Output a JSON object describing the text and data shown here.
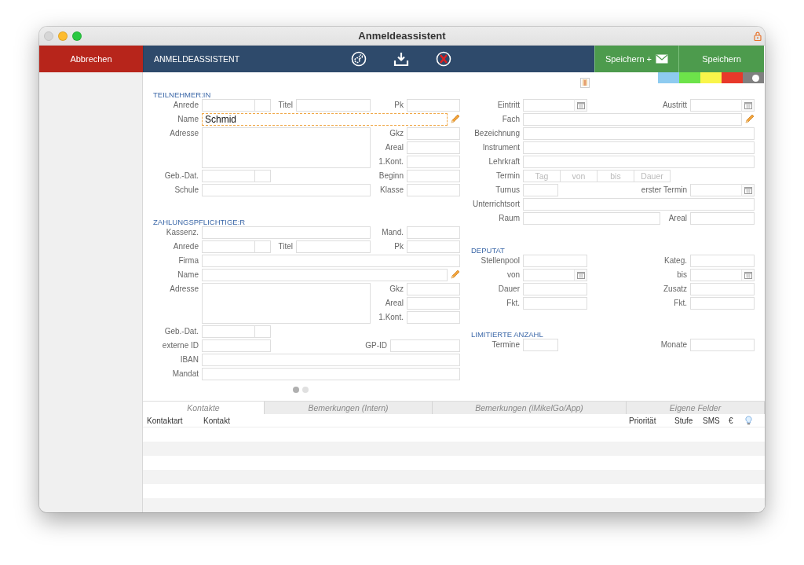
{
  "window": {
    "title": "Anmeldeassistent",
    "controls": [
      {
        "kind": "close",
        "disabled": true
      },
      {
        "kind": "minimize",
        "disabled": false
      },
      {
        "kind": "zoom",
        "disabled": false
      }
    ]
  },
  "toolbar": {
    "cancel": "Abbrechen",
    "title": "ANMELDEASSISTENT",
    "save_mail": "Speichern +",
    "save": "Speichern"
  },
  "color_tags": [
    {
      "color": "#8ecbf0",
      "selected": false
    },
    {
      "color": "#6de34a",
      "selected": false
    },
    {
      "color": "#f9f54a",
      "selected": false
    },
    {
      "color": "#e8382a",
      "selected": false
    },
    {
      "color": "#808080",
      "selected": true
    }
  ],
  "participant": {
    "heading": "TEILNEHMER:IN",
    "fields": [
      {
        "label": "Anrede",
        "kind": "split",
        "focused": false
      },
      {
        "label": "Titel",
        "kind": "text",
        "focused": false
      },
      {
        "label": "Pk",
        "kind": "text",
        "focused": false
      },
      {
        "label": "Name",
        "kind": "edit",
        "value": "Schmid",
        "focused": true
      },
      {
        "label": "Adresse",
        "kind": "area",
        "focused": false
      },
      {
        "label": "Gkz",
        "kind": "text",
        "focused": false
      },
      {
        "label": "Areal",
        "kind": "text",
        "focused": false
      },
      {
        "label": "1.Kont.",
        "kind": "text",
        "focused": false
      },
      {
        "label": "Geb.-Dat.",
        "kind": "split",
        "focused": false
      },
      {
        "label": "Beginn",
        "kind": "text",
        "focused": false
      },
      {
        "label": "Schule",
        "kind": "text",
        "focused": false
      },
      {
        "label": "Klasse",
        "kind": "text",
        "focused": false
      }
    ]
  },
  "payer": {
    "heading": "ZAHLUNGSPFLICHTIGE:R",
    "fields": [
      {
        "label": "Kassenz.",
        "kind": "text",
        "focused": false
      },
      {
        "label": "Mand.",
        "kind": "text",
        "focused": false
      },
      {
        "label": "Anrede",
        "kind": "split",
        "focused": false
      },
      {
        "label": "Titel",
        "kind": "text",
        "focused": false
      },
      {
        "label": "Pk",
        "kind": "text",
        "focused": false
      },
      {
        "label": "Firma",
        "kind": "text",
        "focused": false
      },
      {
        "label": "Name",
        "kind": "edit",
        "focused": false
      },
      {
        "label": "Adresse",
        "kind": "area",
        "focused": false
      },
      {
        "label": "Gkz",
        "kind": "text",
        "focused": false
      },
      {
        "label": "Areal",
        "kind": "text",
        "focused": false
      },
      {
        "label": "1.Kont.",
        "kind": "text",
        "focused": false
      },
      {
        "label": "Geb.-Dat.",
        "kind": "split",
        "focused": false
      },
      {
        "label": "externe ID",
        "kind": "text",
        "focused": false
      },
      {
        "label": "GP-ID",
        "kind": "text",
        "focused": false
      },
      {
        "label": "IBAN",
        "kind": "text",
        "focused": false
      },
      {
        "label": "Mandat",
        "kind": "text",
        "focused": false
      }
    ]
  },
  "course": {
    "fields": [
      {
        "label": "Eintritt",
        "kind": "date",
        "focused": false
      },
      {
        "label": "Austritt",
        "kind": "date",
        "focused": false
      },
      {
        "label": "Fach",
        "kind": "edit",
        "focused": false
      },
      {
        "label": "Bezeichnung",
        "kind": "text",
        "focused": false
      },
      {
        "label": "Instrument",
        "kind": "text",
        "focused": false
      },
      {
        "label": "Lehrkraft",
        "kind": "text",
        "focused": false
      },
      {
        "label": "Termin",
        "kind": "segments",
        "placeholders": [
          "Tag",
          "von",
          "bis",
          "Dauer"
        ],
        "focused": false
      },
      {
        "label": "Turnus",
        "kind": "text",
        "focused": false
      },
      {
        "label": "erster Termin",
        "kind": "date",
        "focused": false
      },
      {
        "label": "Unterrichtsort",
        "kind": "text",
        "focused": false
      },
      {
        "label": "Raum",
        "kind": "text",
        "focused": false
      },
      {
        "label": "Areal",
        "kind": "text",
        "focused": false
      }
    ]
  },
  "deputat": {
    "heading": "DEPUTAT",
    "fields": [
      {
        "label": "Stellenpool",
        "kind": "text",
        "focused": false
      },
      {
        "label": "Kateg.",
        "kind": "text",
        "focused": false
      },
      {
        "label": "von",
        "kind": "date",
        "focused": false
      },
      {
        "label": "bis",
        "kind": "date",
        "focused": false
      },
      {
        "label": "Dauer",
        "kind": "text",
        "focused": false
      },
      {
        "label": "Zusatz",
        "kind": "text",
        "focused": false
      },
      {
        "label": "Fkt.",
        "kind": "text",
        "focused": false
      },
      {
        "label": "Fkt.",
        "kind": "text",
        "focused": false
      }
    ]
  },
  "limited": {
    "heading": "LIMITIERTE ANZAHL",
    "fields": [
      {
        "label": "Termine",
        "kind": "text",
        "focused": false
      },
      {
        "label": "Monate",
        "kind": "text",
        "focused": false
      }
    ]
  },
  "pager": [
    {
      "selected": true
    },
    {
      "selected": false
    }
  ],
  "tabs": [
    {
      "label": "Kontakte",
      "selected": true
    },
    {
      "label": "Bemerkungen (Intern)",
      "selected": false
    },
    {
      "label": "Bemerkungen (iMikelGo/App)",
      "selected": false
    },
    {
      "label": "Eigene Felder",
      "selected": false
    }
  ],
  "contacts_table": {
    "columns": [
      "Kontaktart",
      "Kontakt",
      "Priorität",
      "Stufe",
      "SMS",
      "€"
    ]
  }
}
